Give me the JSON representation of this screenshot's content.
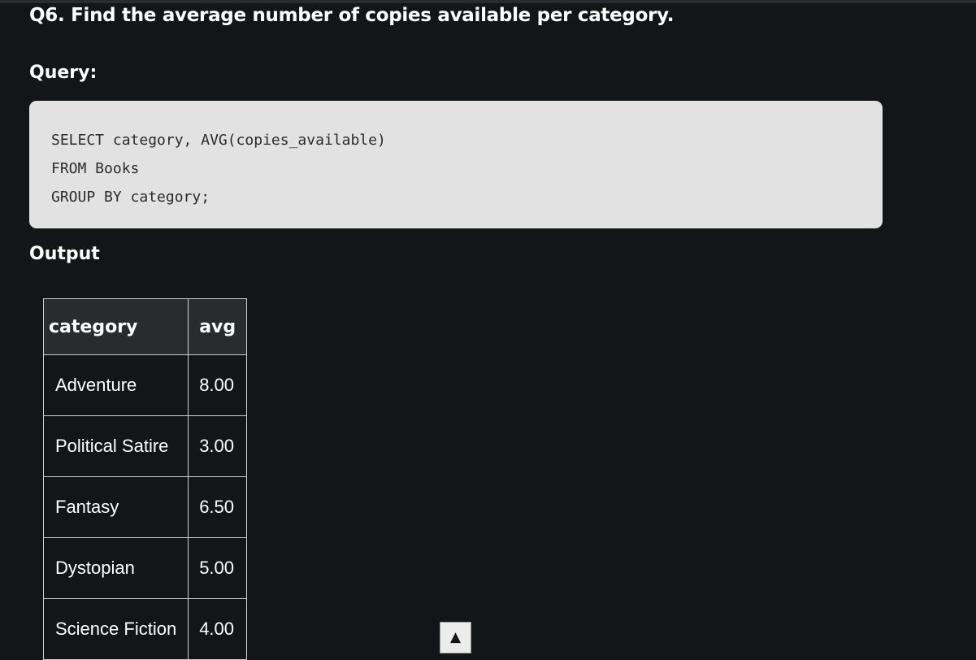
{
  "question": "Q6. Find the average number of copies available per category.",
  "query_heading": "Query:",
  "code": {
    "lines": [
      "SELECT category, AVG(copies_available)",
      "FROM Books",
      "GROUP BY category;"
    ]
  },
  "output_heading": "Output",
  "table": {
    "headers": [
      "category",
      "avg"
    ],
    "rows": [
      [
        "Adventure",
        "8.00"
      ],
      [
        "Political Satire",
        "3.00"
      ],
      [
        "Fantasy",
        "6.50"
      ],
      [
        "Dystopian",
        "5.00"
      ],
      [
        "Science Fiction",
        "4.00"
      ]
    ]
  },
  "scroll_button": {
    "icon": "arrow-up-icon",
    "glyph": "▲"
  }
}
